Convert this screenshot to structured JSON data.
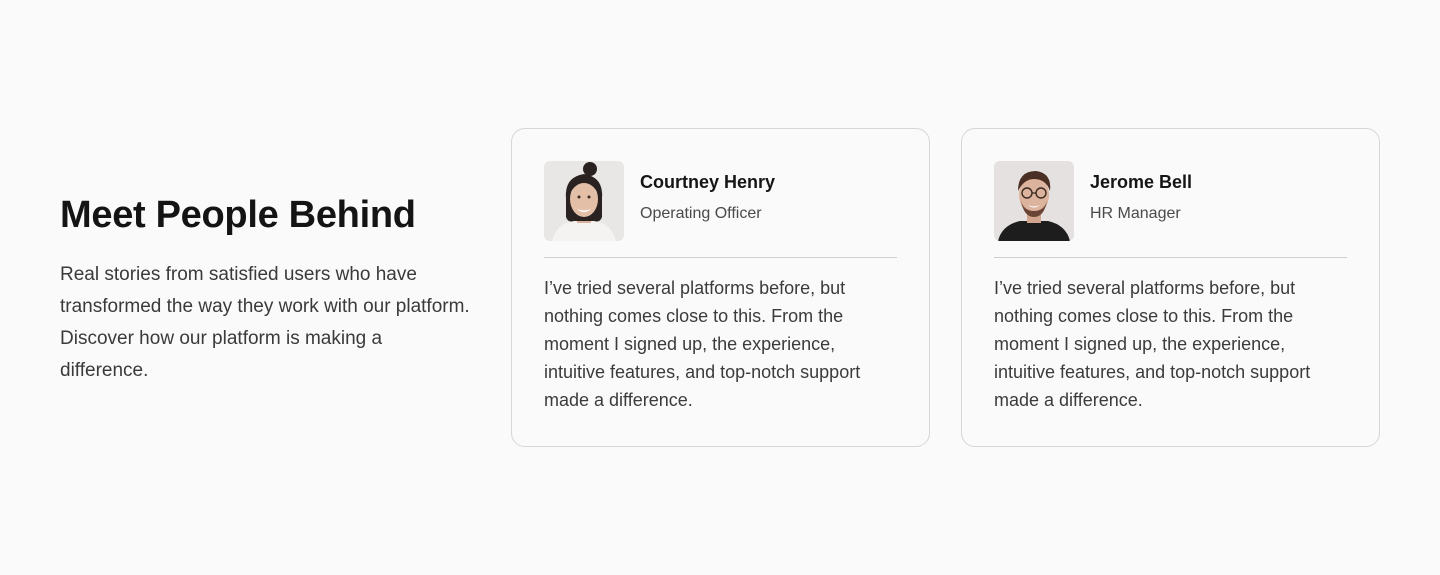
{
  "intro": {
    "title": "Meet People Behind",
    "description": "Real stories from satisfied users who have transformed the way they work with our platform. Discover how our platform is making a difference."
  },
  "testimonials": [
    {
      "name": "Courtney Henry",
      "role": "Operating Officer",
      "avatar": "woman-portrait",
      "quote": "I’ve tried several platforms before, but nothing comes close to this. From the moment I signed up, the experience, intuitive features, and top-notch support made a difference."
    },
    {
      "name": "Jerome Bell",
      "role": "HR Manager",
      "avatar": "man-portrait",
      "quote": "I’ve tried several platforms before, but nothing comes close to this. From the moment I signed up, the experience, intuitive features, and top-notch support made a difference."
    }
  ]
}
